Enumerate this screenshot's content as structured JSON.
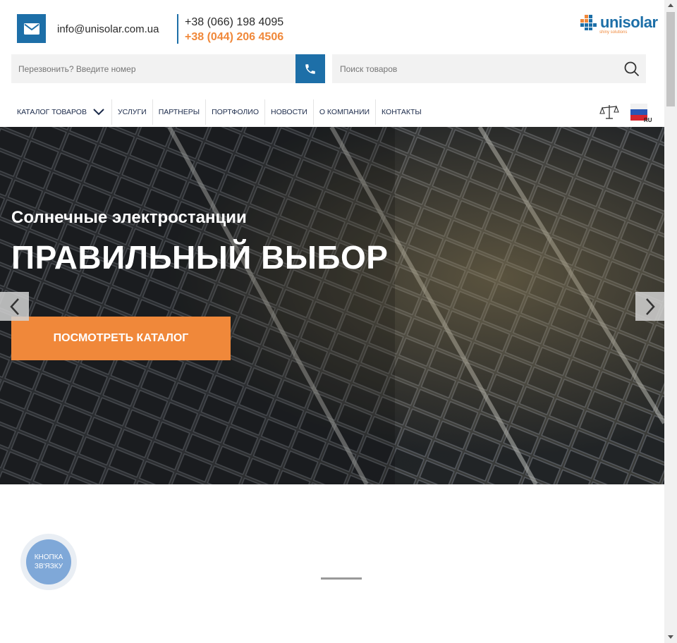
{
  "header": {
    "email": "info@unisolar.com.ua",
    "phone_primary": "+38 (066) 198 4095",
    "phone_secondary": "+38 (044) 206 4506",
    "logo_text": "unisolar",
    "logo_tagline": "shiny solutions",
    "icons": {
      "mail": "envelope-icon",
      "callback": "phone-icon",
      "search": "search-icon"
    }
  },
  "search": {
    "callback_placeholder": "Перезвонить? Введите номер",
    "search_placeholder": "Поиск товаров"
  },
  "nav": {
    "items": [
      {
        "label": "КАТАЛОГ ТОВАРОВ"
      },
      {
        "label": "УСЛУГИ"
      },
      {
        "label": "ПАРТНЕРЫ"
      },
      {
        "label": "ПОРТФОЛИО"
      },
      {
        "label": "НОВОСТИ"
      },
      {
        "label": "О КОМПАНИИ"
      },
      {
        "label": "КОНТАКТЫ"
      }
    ],
    "language": "RU"
  },
  "hero": {
    "subtitle": "Солнечные электростанции",
    "title": "ПРАВИЛЬНЫЙ ВЫБОР",
    "button_label": "ПОСМОТРЕТЬ КАТАЛОГ"
  },
  "callback_widget": {
    "line1": "КНОПКА",
    "line2": "ЗВ'ЯЗКУ"
  },
  "colors": {
    "brand_blue": "#1d6fa8",
    "accent_orange": "#f0883a",
    "nav_text": "#1b2a4a",
    "widget_blue": "#7fa8d8"
  }
}
